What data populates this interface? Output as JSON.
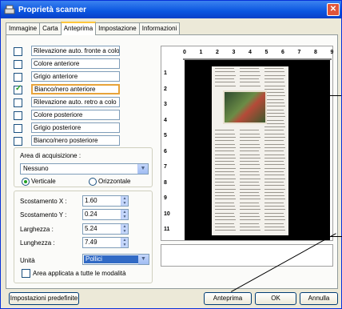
{
  "window": {
    "title": "Proprietà scanner"
  },
  "tabs": [
    "Immagine",
    "Carta",
    "Anteprima",
    "Impostazione",
    "Informazioni"
  ],
  "active_tab": "Anteprima",
  "image_modes": [
    {
      "label": "Rilevazione auto. fronte a colo",
      "checked": false,
      "selected": false
    },
    {
      "label": "Colore anteriore",
      "checked": false,
      "selected": false
    },
    {
      "label": "Grigio anteriore",
      "checked": false,
      "selected": false
    },
    {
      "label": "Bianco/nero anteriore",
      "checked": true,
      "selected": true
    },
    {
      "label": "Rilevazione auto. retro a colo",
      "checked": false,
      "selected": false
    },
    {
      "label": "Colore posteriore",
      "checked": false,
      "selected": false
    },
    {
      "label": "Grigio posteriore",
      "checked": false,
      "selected": false
    },
    {
      "label": "Bianco/nero posteriore",
      "checked": false,
      "selected": false
    }
  ],
  "area": {
    "label": "Area di acquisizione :",
    "value": "Nessuno",
    "orientation_vertical": "Verticale",
    "orientation_horizontal": "Orizzontale",
    "selected_orientation": "Verticale"
  },
  "fields": {
    "offset_x_label": "Scostamento X :",
    "offset_x": "1.60",
    "offset_y_label": "Scostamento Y :",
    "offset_y": "0.24",
    "width_label": "Larghezza :",
    "width": "5.24",
    "length_label": "Lunghezza :",
    "length": "7.49",
    "unit_label": "Unità",
    "unit": "Pollici",
    "apply_all_label": "Area applicata a tutte le modalità"
  },
  "ruler": {
    "top": [
      "0",
      "1",
      "2",
      "3",
      "4",
      "5",
      "6",
      "7",
      "8",
      "9"
    ],
    "left": [
      "1",
      "2",
      "3",
      "4",
      "5",
      "6",
      "7",
      "8",
      "9",
      "10",
      "11"
    ]
  },
  "buttons": {
    "defaults": "Impostazioni predefinite",
    "preview": "Anteprima",
    "ok": "OK",
    "cancel": "Annulla"
  },
  "colors": {
    "title_bar": "#0a55e0",
    "selection": "#316ac5",
    "highlight": "#e8a33a"
  },
  "icons": [
    "scanner-icon",
    "close-icon",
    "chevron-down-icon"
  ]
}
